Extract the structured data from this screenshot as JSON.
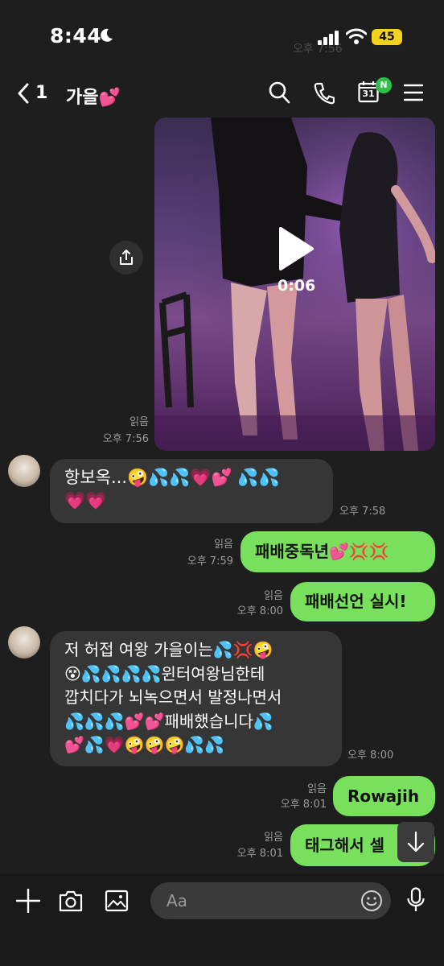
{
  "status_bar": {
    "time": "8:44",
    "battery": "45",
    "ghost_time": "오후 7:56"
  },
  "header": {
    "back_count": "1",
    "title": "가을💕",
    "calendar_day": "31",
    "calendar_badge": "N"
  },
  "video_message": {
    "duration": "0:06",
    "read_label": "읽음",
    "time": "오후 7:56"
  },
  "messages": [
    {
      "direction": "in",
      "lines": [
        "항보옥...🤪💦💦💗💕 💦💦",
        "💗💗"
      ],
      "time": "오후 7:58"
    },
    {
      "direction": "out",
      "text": "패배중독년💕💢💢",
      "read_label": "읽음",
      "time": "오후 7:59"
    },
    {
      "direction": "out",
      "text": "패배선언 실시!",
      "read_label": "읽음",
      "time": "오후 8:00"
    },
    {
      "direction": "in",
      "lines": [
        "저 허접 여왕 가을이는💦💢🤪",
        "😵💦💦💦💦윈터여왕님한테",
        "깝치다가 뇌녹으면서 발정나면서",
        "💦💦💦💕💕패배했습니다💦",
        "💕💦💗🤪🤪🤪💦💦"
      ],
      "time": "오후 8:00"
    },
    {
      "direction": "out",
      "text": "Rowajih",
      "read_label": "읽음",
      "time": "오후 8:01"
    },
    {
      "direction": "out",
      "text": "태그해서 셀",
      "read_label": "읽음",
      "time": "오후 8:01"
    }
  ],
  "input": {
    "placeholder": "Aa"
  },
  "colors": {
    "background": "#1e1e1e",
    "outgoing_bubble": "#79e05e",
    "incoming_bubble": "#363636",
    "badge": "#2fc04a",
    "battery": "#f2d21c"
  },
  "icons": [
    "moon-icon",
    "signal-icon",
    "wifi-icon",
    "back-chevron-icon",
    "search-icon",
    "phone-icon",
    "calendar-icon",
    "menu-icon",
    "share-icon",
    "play-icon",
    "plus-icon",
    "camera-icon",
    "image-icon",
    "emoji-icon",
    "microphone-icon",
    "arrow-down-icon"
  ]
}
